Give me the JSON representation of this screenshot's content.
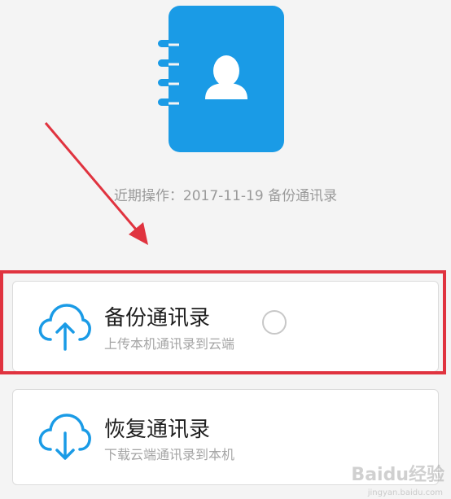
{
  "header": {
    "recent_operation": "近期操作：2017-11-19 备份通讯录"
  },
  "options": [
    {
      "title": "备份通讯录",
      "subtitle": "上传本机通讯录到云端",
      "icon": "cloud-upload-icon",
      "selected": false
    },
    {
      "title": "恢复通讯录",
      "subtitle": "下载云端通讯录到本机",
      "icon": "cloud-download-icon"
    }
  ],
  "watermark": {
    "brand": "Baidu经验",
    "url": "jingyan.baidu.com"
  },
  "colors": {
    "accent": "#1a9be6",
    "highlight": "#e0333f",
    "background": "#f4f4f4"
  }
}
